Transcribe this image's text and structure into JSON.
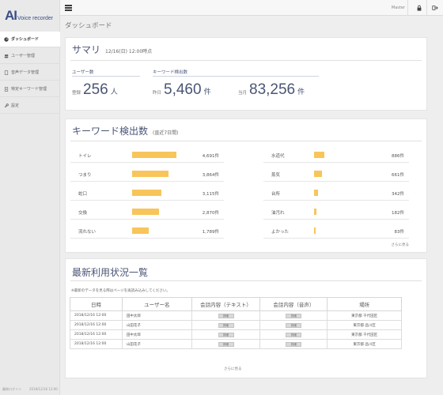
{
  "app": {
    "logo_ai": "AI",
    "logo_rest": "Voice recorder"
  },
  "sidebar": {
    "items": [
      {
        "label": "ダッシュボード",
        "icon": "dashboard-icon"
      },
      {
        "label": "ユーザー管理",
        "icon": "users-icon"
      },
      {
        "label": "音声データ管理",
        "icon": "file-icon"
      },
      {
        "label": "特定キーワード管理",
        "icon": "document-icon"
      },
      {
        "label": "設定",
        "icon": "wrench-icon"
      }
    ],
    "footer_label": "最終ログイン",
    "footer_time": "2018/12/16 12:00"
  },
  "topbar": {
    "user": "Master",
    "lock_icon": "lock-icon",
    "logout_icon": "logout-icon"
  },
  "page_title": "ダッシュボード",
  "summary": {
    "title": "サマリ",
    "timestamp": "12/16(日) 12:00時点",
    "users_label": "ユーザー数",
    "registered_label": "登録",
    "registered_value": "256",
    "registered_unit": "人",
    "keyword_label": "キーワード検出数",
    "yesterday_label": "昨日",
    "yesterday_value": "5,460",
    "yesterday_unit": "件",
    "month_label": "当月",
    "month_value": "83,256",
    "month_unit": "件"
  },
  "keywords": {
    "title": "キーワード検出数",
    "subtitle": "(直近7日間)",
    "more": "さらに見る",
    "bar_color": "#f7c55a",
    "left": [
      {
        "name": "トイレ",
        "count": "4,691件",
        "value": 4691
      },
      {
        "name": "つまり",
        "count": "3,864件",
        "value": 3864
      },
      {
        "name": "蛇口",
        "count": "3,115件",
        "value": 3115
      },
      {
        "name": "交換",
        "count": "2,870件",
        "value": 2870
      },
      {
        "name": "流れない",
        "count": "1,789件",
        "value": 1789
      }
    ],
    "right": [
      {
        "name": "水道代",
        "count": "886件",
        "value": 886
      },
      {
        "name": "蒸気",
        "count": "661件",
        "value": 661
      },
      {
        "name": "台所",
        "count": "342件",
        "value": 342
      },
      {
        "name": "油汚れ",
        "count": "182件",
        "value": 182
      },
      {
        "name": "よかった",
        "count": "83件",
        "value": 83
      }
    ]
  },
  "recent": {
    "title": "最新利用状況一覧",
    "note": "※最新のデータを見る際はページを再読み込みしてください。",
    "columns": [
      "日時",
      "ユーザー名",
      "会話内容（テキスト）",
      "会話内容（音声）",
      "場所"
    ],
    "detail_label": "詳細",
    "rows": [
      {
        "datetime": "2018/12/16 12:00",
        "user": "田中太郎",
        "place": "東京都 千代田区"
      },
      {
        "datetime": "2018/12/16 12:00",
        "user": "山田花子",
        "place": "東京都 品川区"
      },
      {
        "datetime": "2018/12/16 12:00",
        "user": "田中太郎",
        "place": "東京都 千代田区"
      },
      {
        "datetime": "2018/12/16 12:00",
        "user": "山田花子",
        "place": "東京都 品川区"
      }
    ],
    "more": "さらに見る"
  }
}
